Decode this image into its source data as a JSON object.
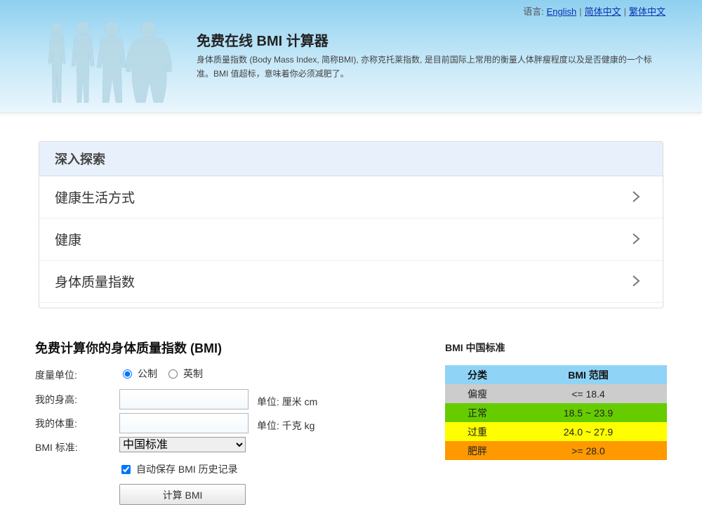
{
  "lang_bar": {
    "label": "语言:",
    "links": [
      "English",
      "简体中文",
      "繁体中文"
    ]
  },
  "header": {
    "title": "免费在线 BMI 计算器",
    "description": "身体质量指数 (Body Mass Index, 简称BMI), 亦称克托莱指数, 是目前国际上常用的衡量人体胖瘦程度以及是否健康的一个标准。BMI 值超标，意味着你必须减肥了。"
  },
  "explore": {
    "heading": "深入探索",
    "items": [
      "健康生活方式",
      "健康",
      "身体质量指数"
    ]
  },
  "calculator": {
    "title": "免费计算你的身体质量指数 (BMI)",
    "unit_label": "度量单位:",
    "unit_options": [
      "公制",
      "英制"
    ],
    "unit_selected": "公制",
    "height_label": "我的身高:",
    "height_value": "",
    "height_unit": "单位: 厘米 cm",
    "weight_label": "我的体重:",
    "weight_value": "",
    "weight_unit": "单位: 千克 kg",
    "standard_label": "BMI 标准:",
    "standard_selected": "中国标准",
    "autosave_label": "自动保存 BMI 历史记录",
    "autosave_checked": true,
    "button_label": "计算 BMI"
  },
  "standard_table": {
    "title": "BMI 中国标准",
    "headers": [
      "分类",
      "BMI 范围"
    ],
    "rows": [
      {
        "category": "偏瘦",
        "range": "<= 18.4",
        "color": "#cccccc"
      },
      {
        "category": "正常",
        "range": "18.5 ~ 23.9",
        "color": "#66cc00"
      },
      {
        "category": "过重",
        "range": "24.0 ~ 27.9",
        "color": "#ffff00"
      },
      {
        "category": "肥胖",
        "range": ">= 28.0",
        "color": "#ff9900"
      }
    ]
  },
  "icons": {
    "chevron": "chevron-right-icon",
    "silhouette": "body-silhouette-icon"
  }
}
